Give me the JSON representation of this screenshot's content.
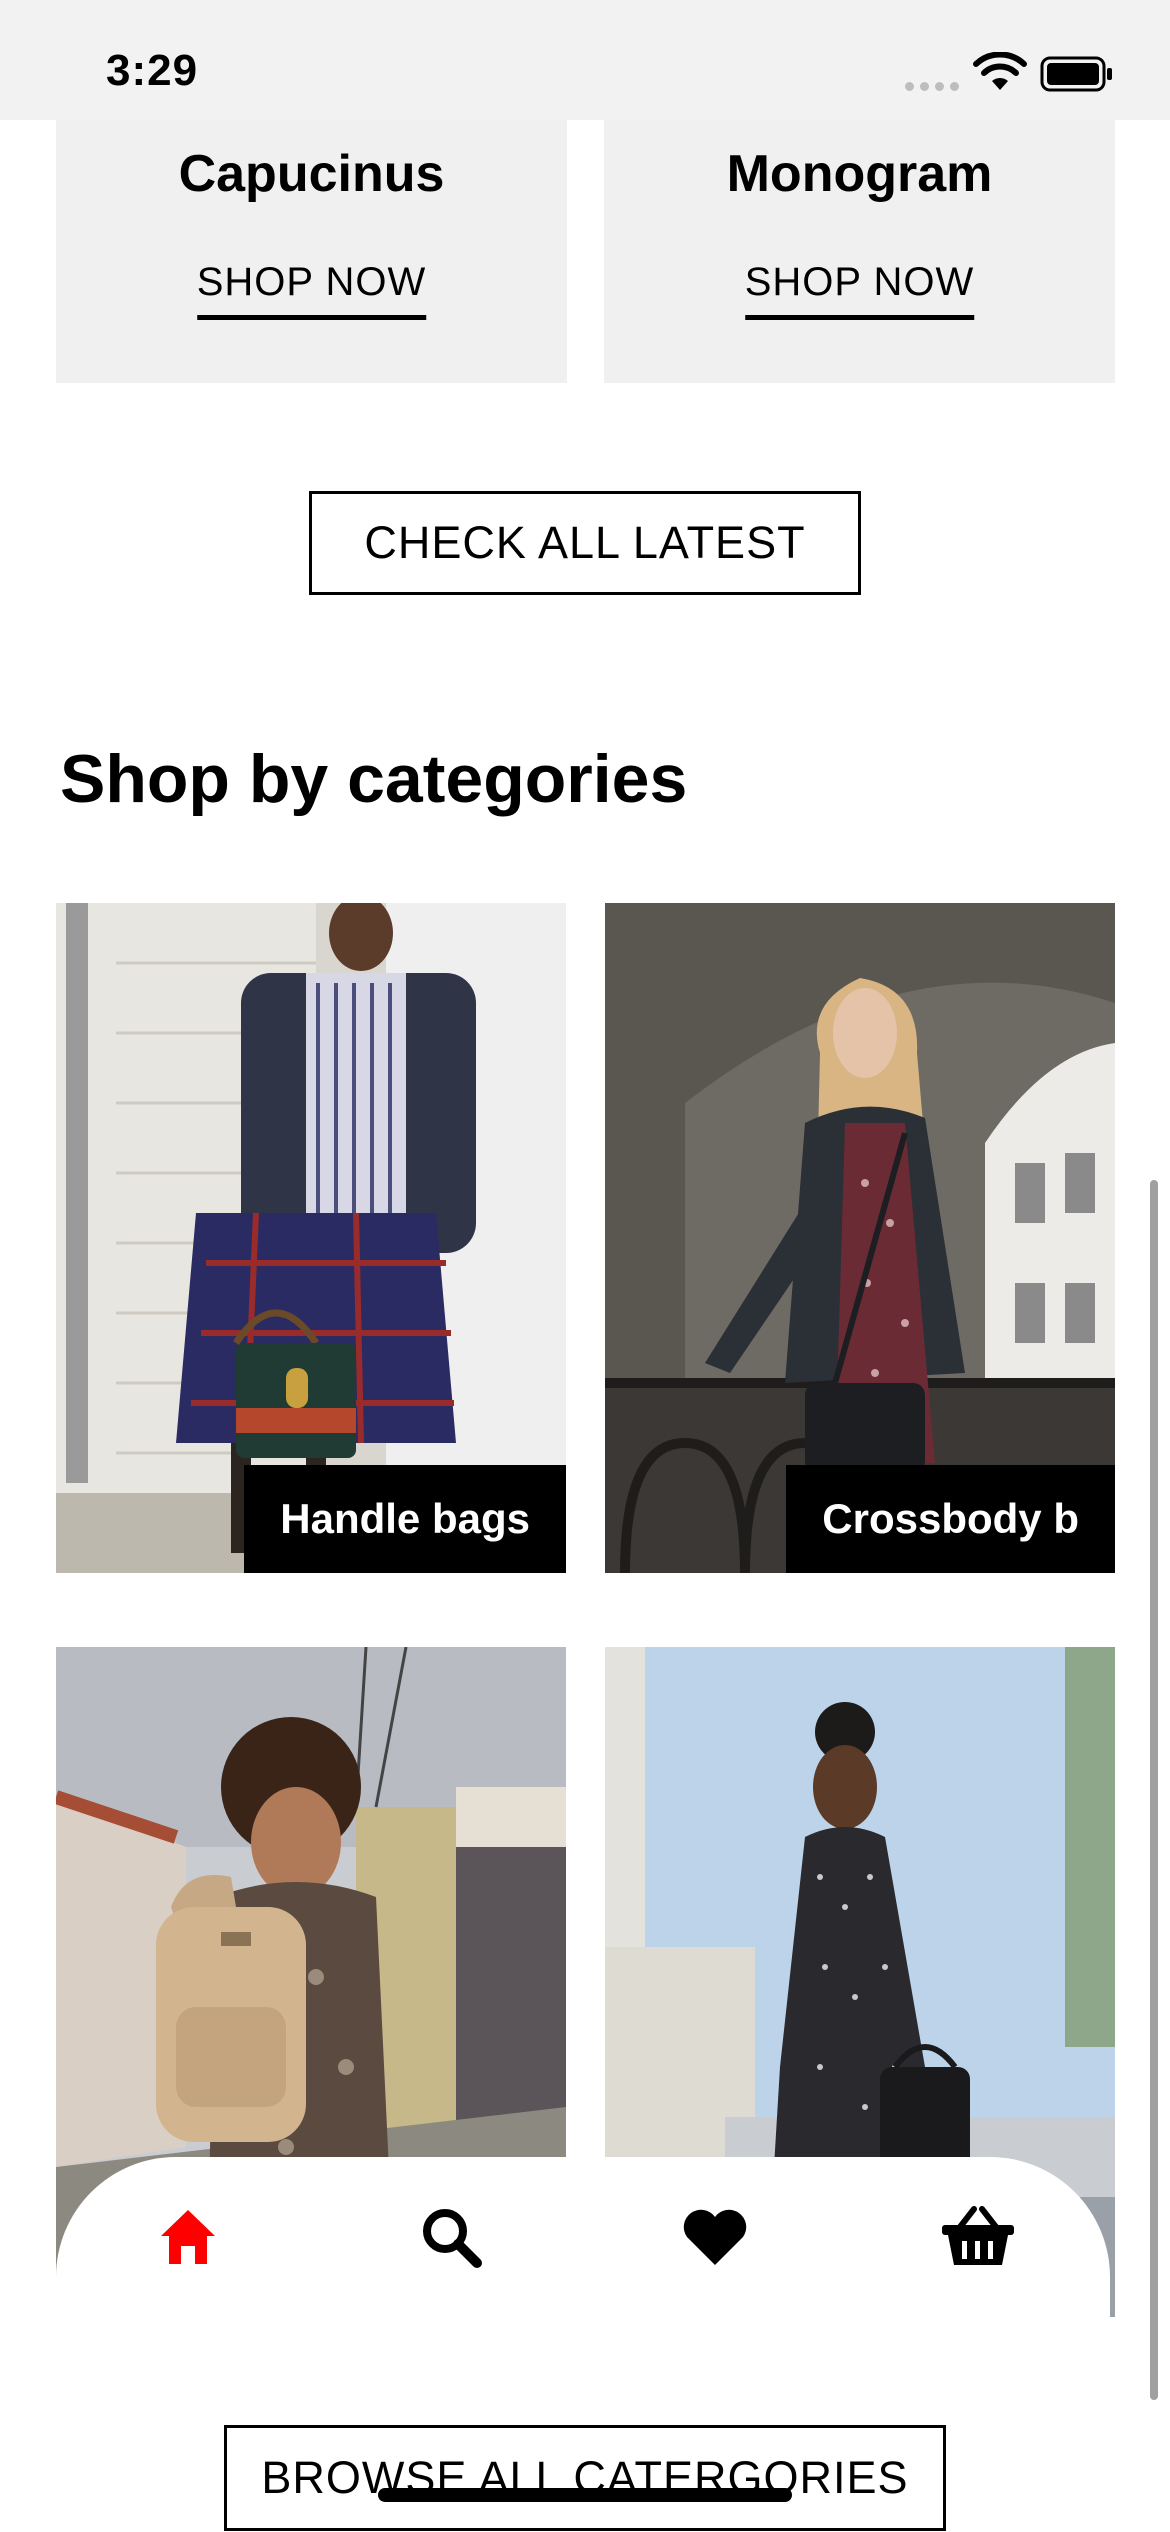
{
  "status": {
    "time": "3:29"
  },
  "products": [
    {
      "name": "Capucinus",
      "cta": "SHOP NOW"
    },
    {
      "name": "Monogram",
      "cta": "SHOP NOW"
    }
  ],
  "check_all_label": "CHECK ALL LATEST",
  "categories_title": "Shop by categories",
  "categories": [
    {
      "label": "Handle bags"
    },
    {
      "label": "Crossbody b"
    }
  ],
  "browse_all_label": "BROWSE ALL CATERGORIES",
  "nav": {
    "items": [
      {
        "icon": "home-icon",
        "active": true
      },
      {
        "icon": "search-icon",
        "active": false
      },
      {
        "icon": "heart-icon",
        "active": false
      },
      {
        "icon": "basket-icon",
        "active": false
      }
    ],
    "active_color": "#ff0000"
  }
}
